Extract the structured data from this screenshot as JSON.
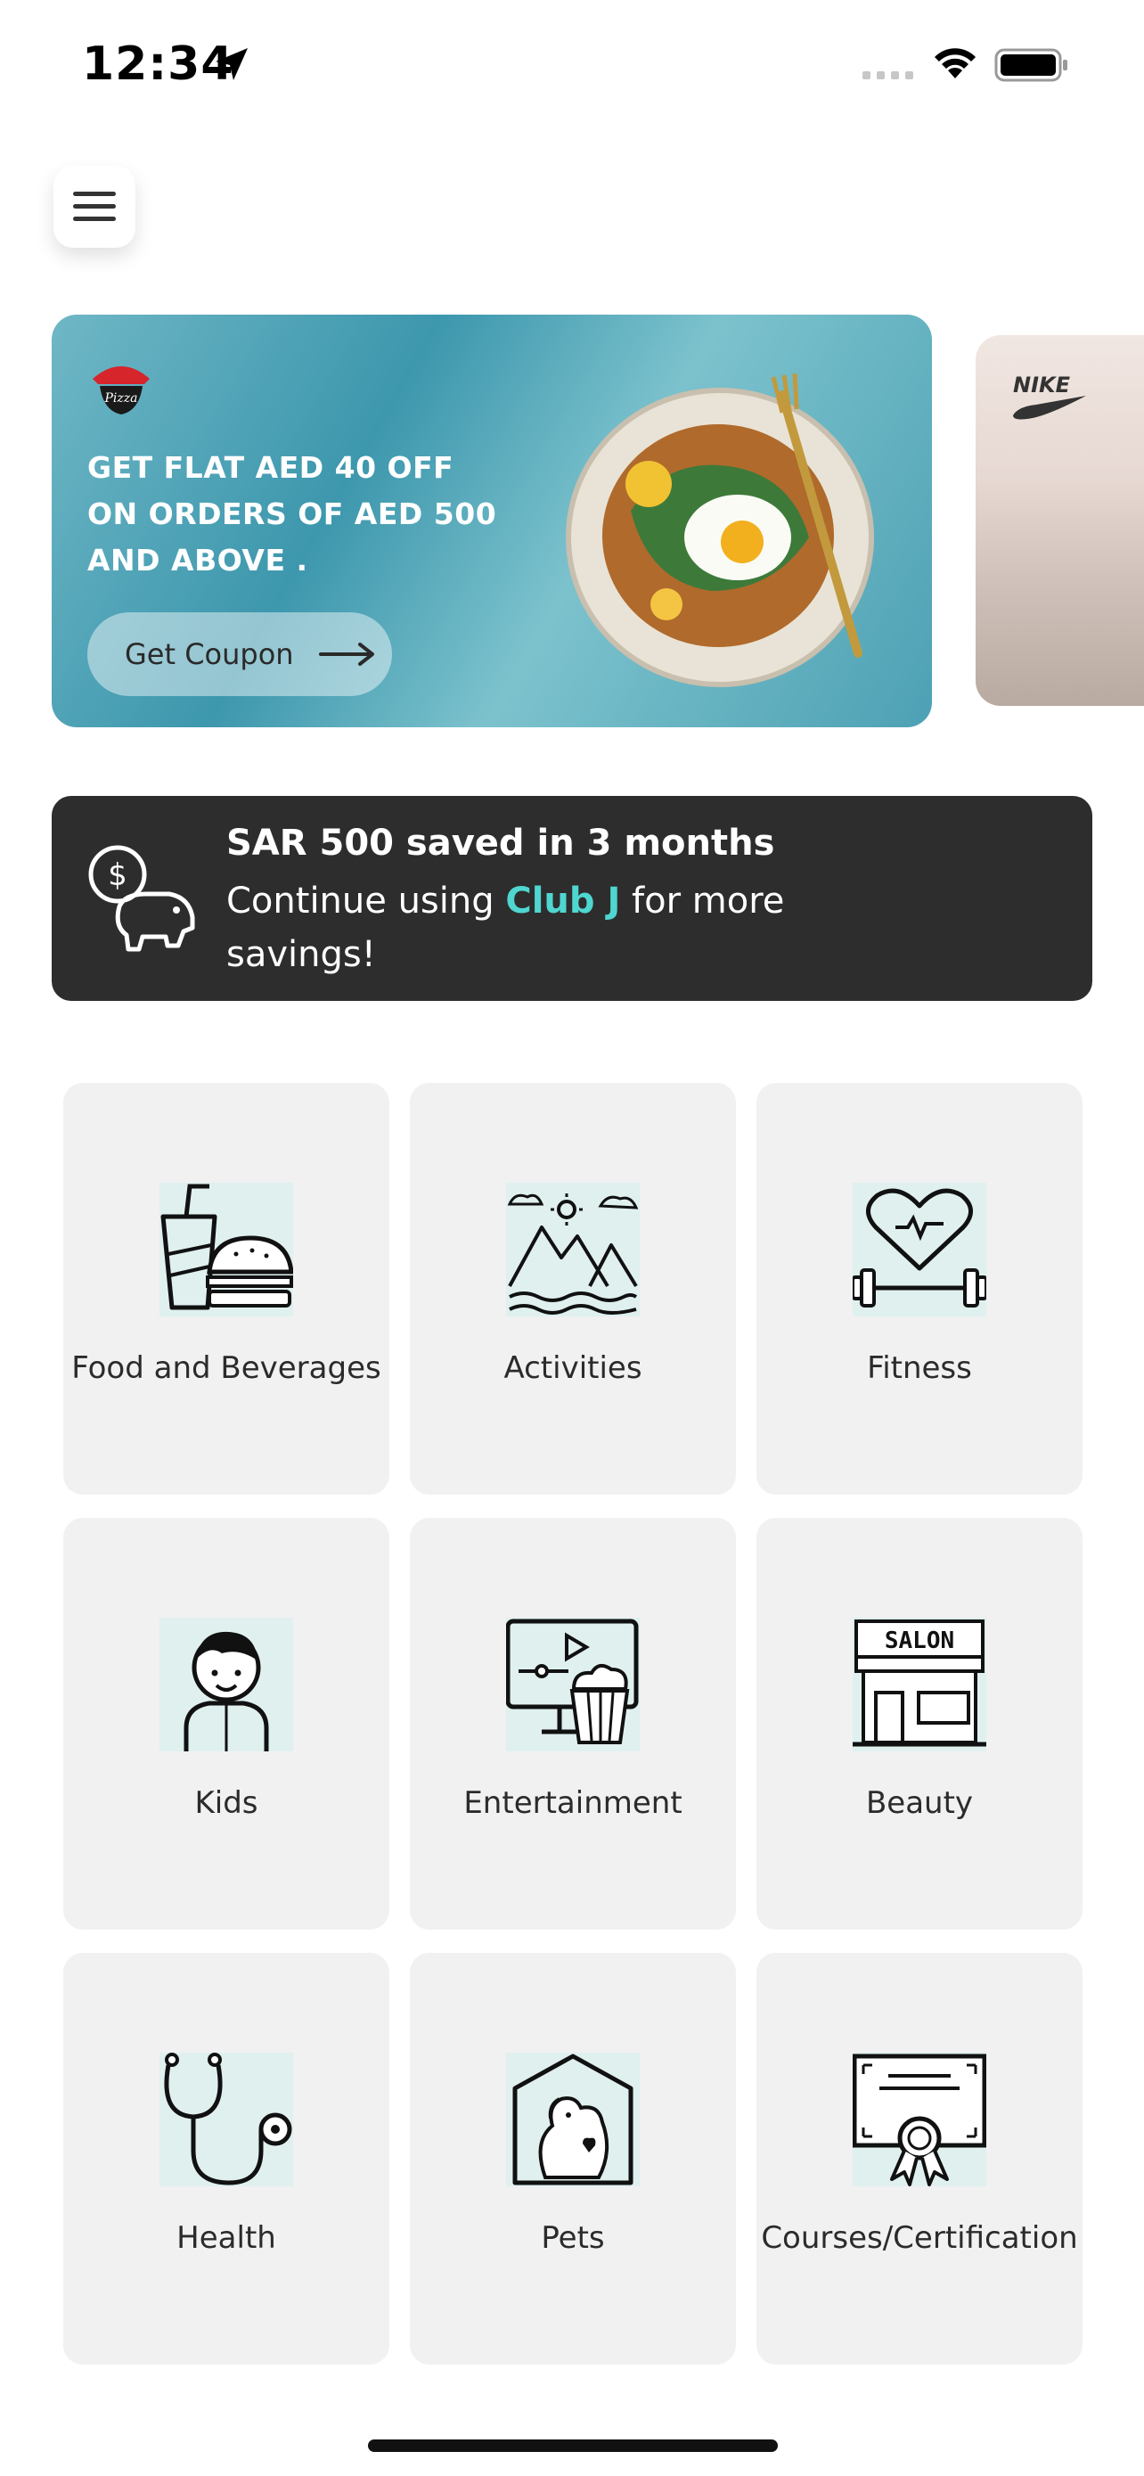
{
  "status_bar": {
    "time": "12:34"
  },
  "banner": {
    "text": "GET FLAT AED 40 OFF ON ORDERS OF AED 500 AND ABOVE .",
    "button_label": "Get Coupon",
    "brand_logo": "Pizza Hut",
    "next_brand": "NIKE"
  },
  "savings": {
    "title": "SAR 500 saved in 3 months",
    "line_prefix": "Continue using ",
    "brand": "Club J",
    "line_suffix": " for more savings!"
  },
  "categories": [
    {
      "label": "Food and Beverages",
      "icon": "food-beverage-icon"
    },
    {
      "label": "Activities",
      "icon": "mountains-icon"
    },
    {
      "label": "Fitness",
      "icon": "heart-dumbbell-icon"
    },
    {
      "label": "Kids",
      "icon": "child-icon"
    },
    {
      "label": "Entertainment",
      "icon": "popcorn-screen-icon"
    },
    {
      "label": "Beauty",
      "icon": "salon-icon"
    },
    {
      "label": "Health",
      "icon": "stethoscope-icon"
    },
    {
      "label": "Pets",
      "icon": "pet-house-icon"
    },
    {
      "label": "Courses/Certification",
      "icon": "certificate-icon"
    }
  ],
  "colors": {
    "icon_bg": "#dff0ef",
    "savings_bg": "#2d2d2d",
    "accent": "#4fd6d0",
    "tile_bg": "#f1f1f1"
  }
}
